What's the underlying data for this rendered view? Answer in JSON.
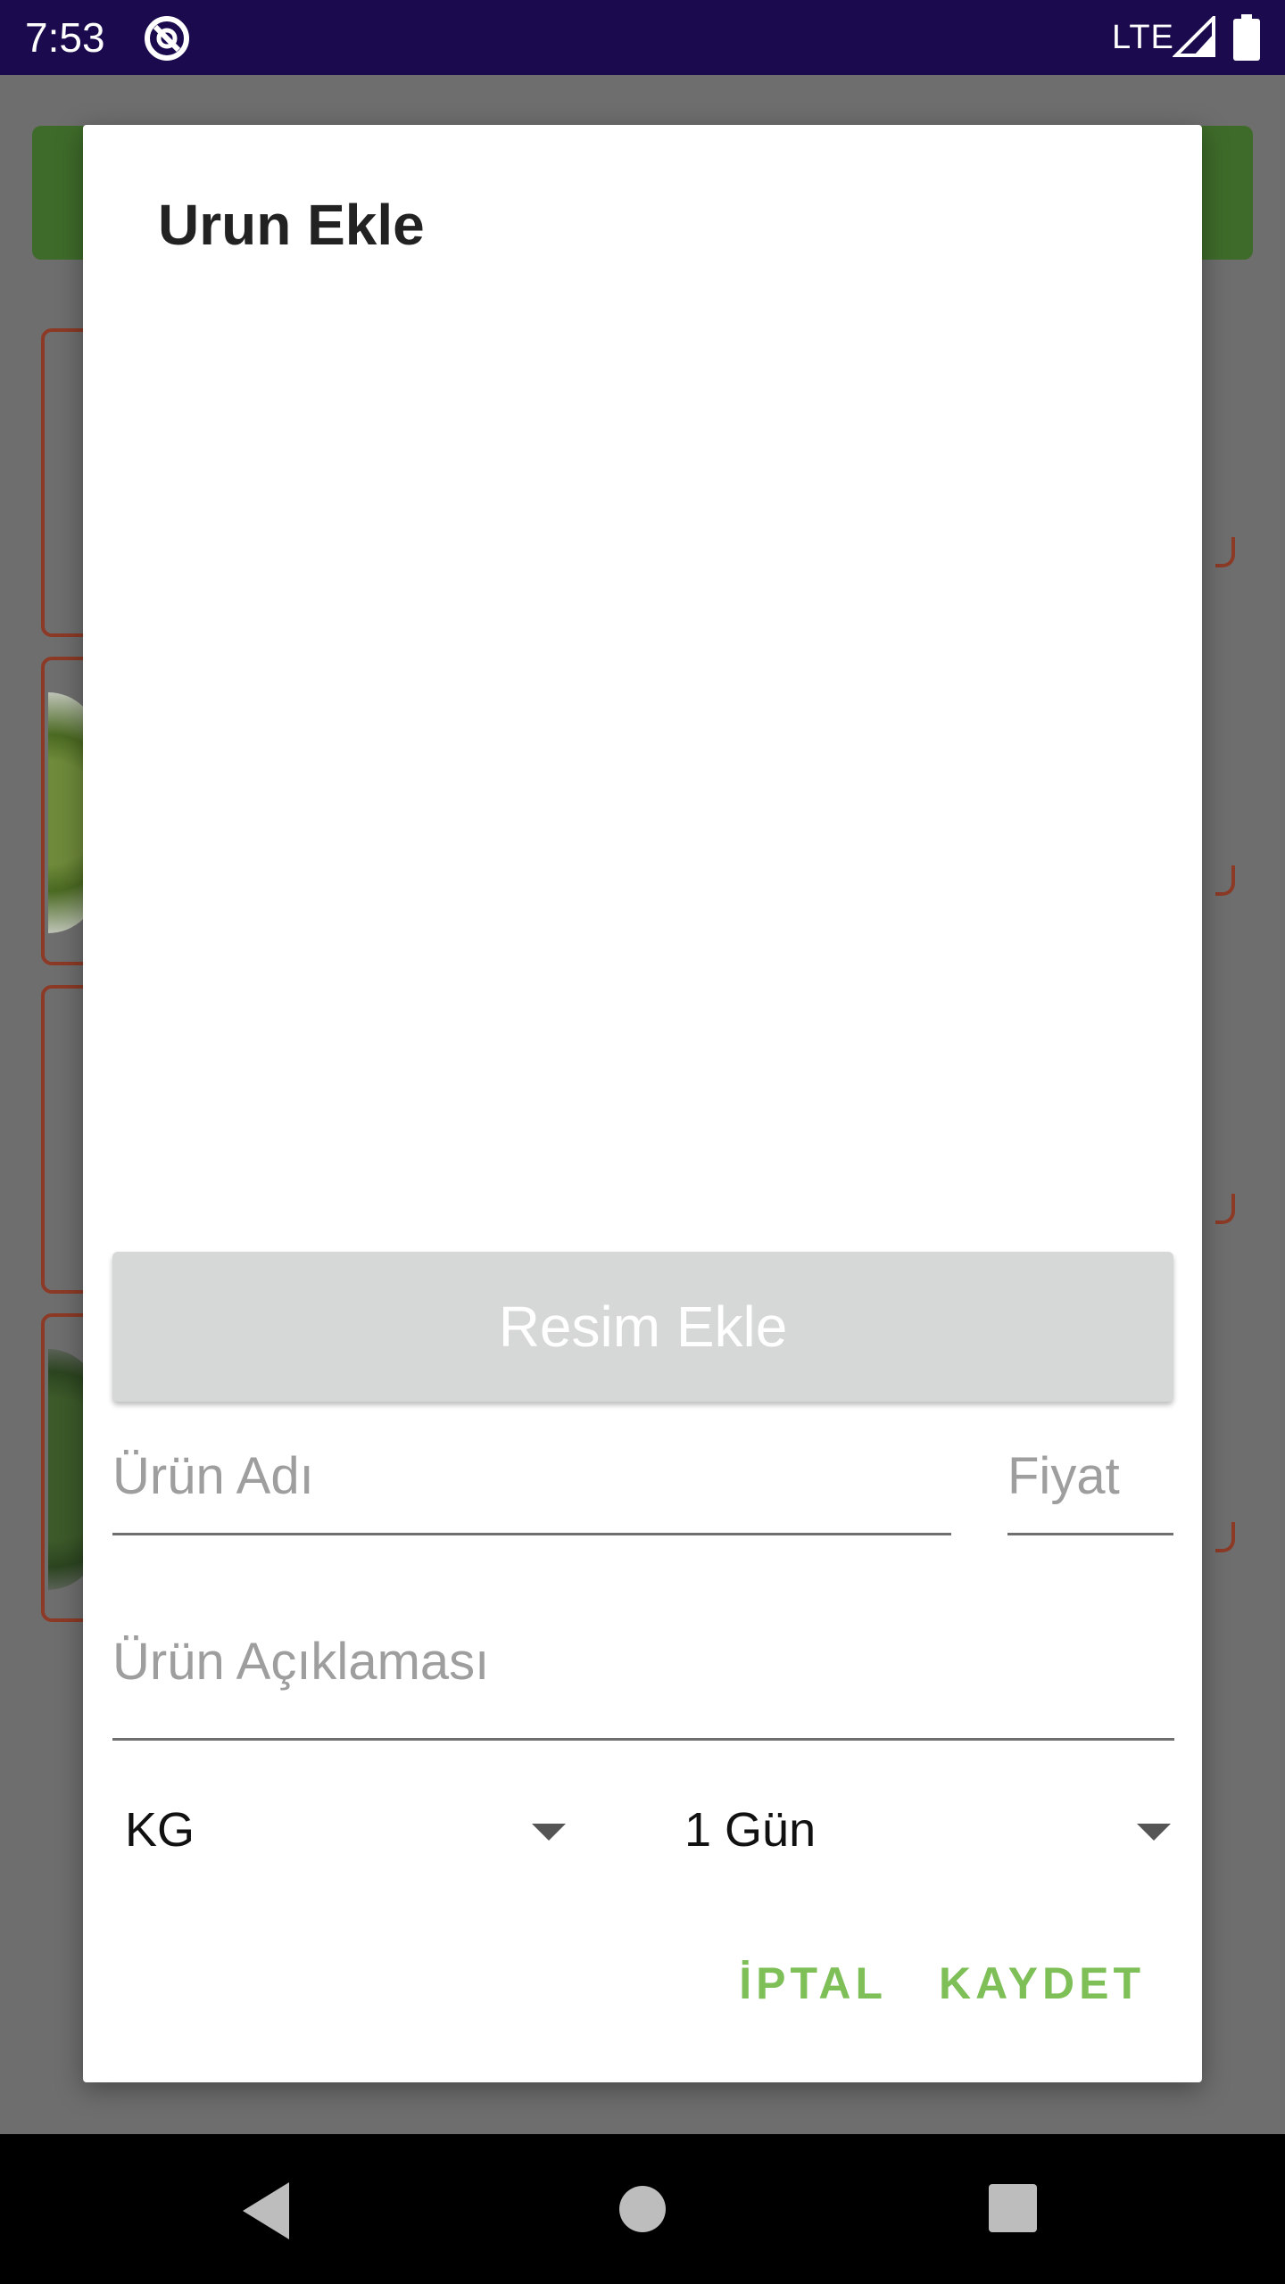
{
  "status_bar": {
    "time": "7:53",
    "network": "LTE",
    "icons": [
      "app-indicator-icon",
      "signal-icon",
      "battery-icon"
    ]
  },
  "dialog": {
    "title": "Urun Ekle",
    "add_image_label": "Resim Ekle",
    "product_name_placeholder": "Ürün Adı",
    "price_placeholder": "Fiyat",
    "description_placeholder": "Ürün Açıklaması",
    "unit_spinner_value": "KG",
    "duration_spinner_value": "1 Gün",
    "cancel_label": "İPTAL",
    "save_label": "KAYDET"
  },
  "colors": {
    "status_bar": "#1b0a4e",
    "accent": "#7ebf58",
    "button_disabled": "#d6d7d7",
    "background_header": "#3e6b2a",
    "card_border": "#8c3a26"
  },
  "nav_bar": {
    "icons": [
      "back-icon",
      "home-icon",
      "recent-apps-icon"
    ]
  }
}
